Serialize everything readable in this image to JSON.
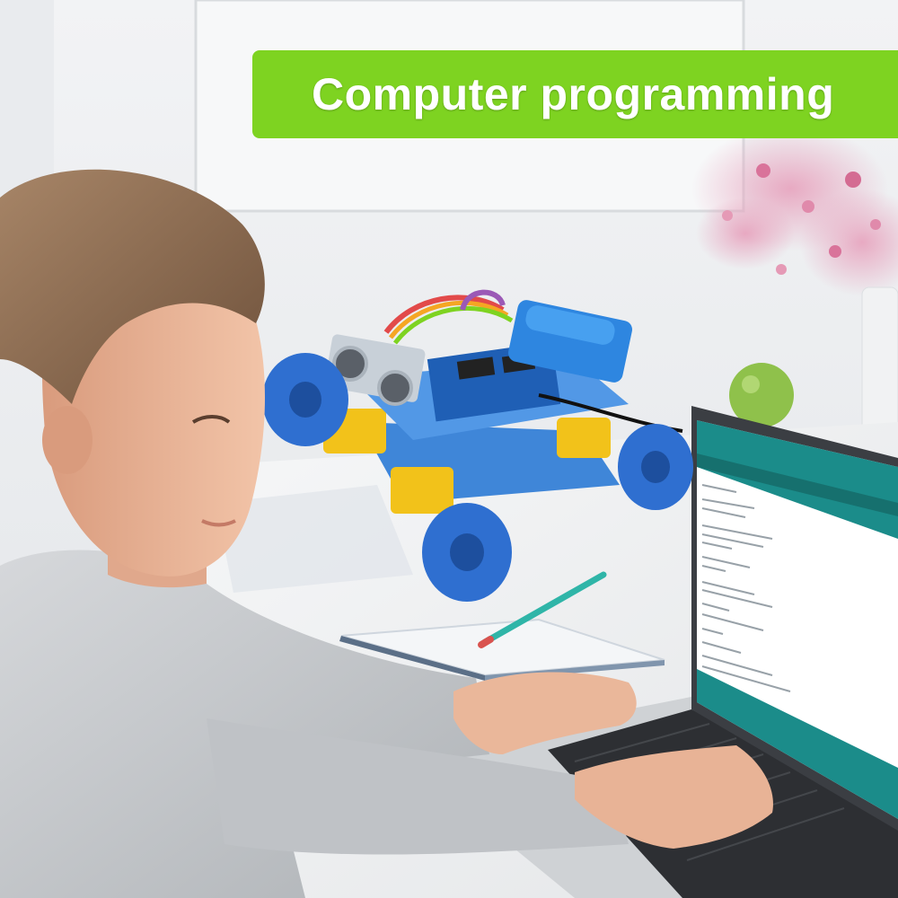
{
  "banner": {
    "title": "Computer programming"
  },
  "colors": {
    "banner_green": "#7ed321",
    "wall": "#eceef1",
    "desk": "#f4f5f6",
    "robot_blue": "#3f86d8",
    "wheel_blue": "#2f6fd0",
    "motor_yellow": "#f2c21a",
    "hoodie_grey": "#c9ccd0",
    "hair_brown": "#8a6a4f",
    "skin": "#eab79a",
    "ide_teal": "#1b8c8a"
  },
  "subjects": [
    "boy-typing",
    "mecanum-robot-car",
    "laptop-with-code-editor",
    "notebook-and-pencil",
    "pink-flowers-vase",
    "green-apple"
  ]
}
